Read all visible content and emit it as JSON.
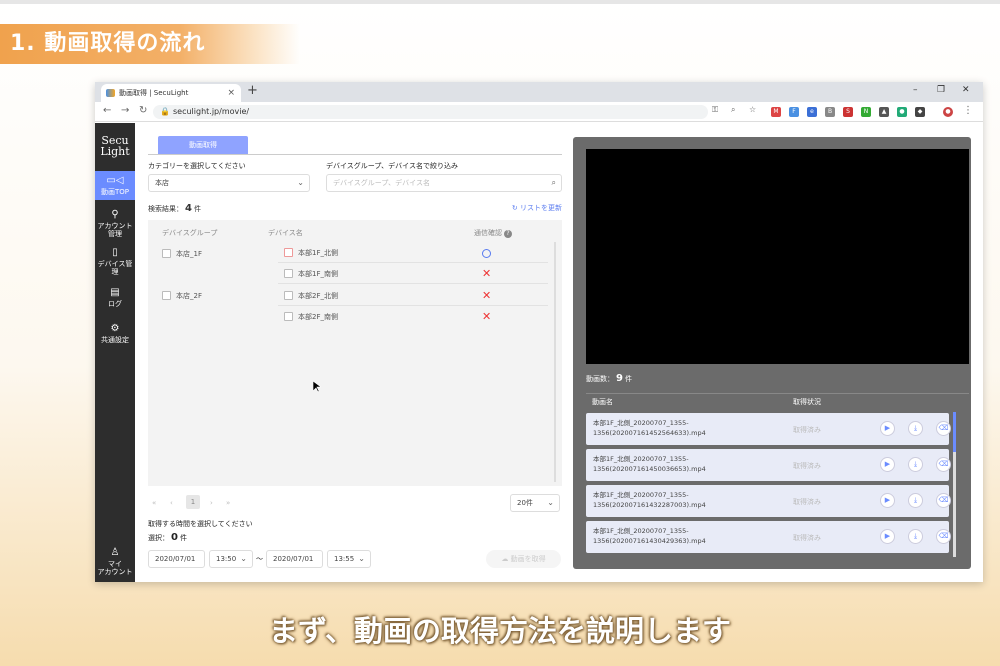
{
  "slide": {
    "title": "1. 動画取得の流れ",
    "caption": "まず、動画の取得方法を説明します"
  },
  "browser": {
    "tab_title": "動画取得 | SecuLight",
    "tab_close": "×",
    "new_tab": "+",
    "url": "seculight.jp/movie/",
    "win_min": "–",
    "win_max": "❐",
    "win_close": "✕"
  },
  "sidebar": {
    "logo_line1": "Secu",
    "logo_line2": "Light",
    "items": [
      {
        "icon": "▭◁",
        "label": "動画TOP",
        "active": true
      },
      {
        "icon": "⚲",
        "label": "アカウント管理"
      },
      {
        "icon": "▯",
        "label": "デバイス管理"
      },
      {
        "icon": "▤",
        "label": "ログ"
      },
      {
        "icon": "⚙",
        "label": "共通設定"
      }
    ],
    "account": {
      "icon": "♙",
      "label_line1": "マイ",
      "label_line2": "アカウント"
    }
  },
  "left": {
    "tab_label": "動画取得",
    "category_label": "カテゴリーを選択してください",
    "category_value": "本店",
    "filter_label": "デバイスグループ、デバイス名で絞り込み",
    "filter_placeholder": "デバイスグループ、デバイス名",
    "results_label": "検索結果：",
    "results_count": "4",
    "results_unit": "件",
    "refresh_label": "リストを更新",
    "table_headers": {
      "group": "デバイスグループ",
      "device": "デバイス名",
      "status": "通信確認"
    },
    "groups": [
      "本店_1F",
      "本店_2F"
    ],
    "devices": [
      {
        "name": "本部1F_北側",
        "status": "ok"
      },
      {
        "name": "本部1F_南側",
        "status": "ng"
      },
      {
        "name": "本部2F_北側",
        "status": "ng"
      },
      {
        "name": "本部2F_南側",
        "status": "ng"
      }
    ],
    "pager": {
      "first": "«",
      "prev": "‹",
      "current": "1",
      "next": "›",
      "last": "»"
    },
    "page_size": "20件",
    "time_label": "取得する時間を選択してください",
    "selected_label": "選択：",
    "selected_count": "0",
    "selected_unit": "件",
    "start_date": "2020/07/01",
    "start_time": "13:50",
    "range_sep": "〜",
    "end_date": "2020/07/01",
    "end_time": "13:55",
    "get_button": "動画を取得"
  },
  "right": {
    "count_label": "動画数：",
    "count_value": "9",
    "count_unit": "件",
    "col_name": "動画名",
    "col_status": "取得状況",
    "videos": [
      {
        "name": "本部1F_北側_20200707_1355-1356(202007161452564633).mp4",
        "status": "取得済み"
      },
      {
        "name": "本部1F_北側_20200707_1355-1356(202007161450036653).mp4",
        "status": "取得済み"
      },
      {
        "name": "本部1F_北側_20200707_1355-1356(202007161432287003).mp4",
        "status": "取得済み"
      },
      {
        "name": "本部1F_北側_20200707_1355-1356(202007161430429363).mp4",
        "status": "取得済み"
      }
    ]
  },
  "icons": {
    "play": "▶",
    "download": "⤓",
    "delete": "🗑"
  },
  "colors": {
    "accent": "#6b8cff",
    "sidebar": "#2d2d2d",
    "error": "#e33333",
    "slide_orange": "#f0a24d"
  }
}
